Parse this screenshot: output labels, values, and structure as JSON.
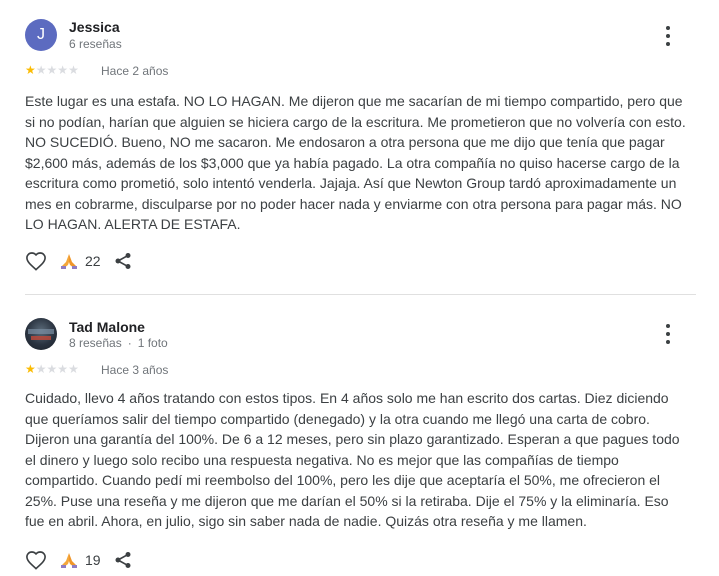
{
  "reviews": [
    {
      "author": "Jessica",
      "avatar_letter": "J",
      "meta": "6 reseñas",
      "rating": 1,
      "max_rating": 5,
      "time": "Hace 2 años",
      "text": "Este lugar es una estafa. NO LO HAGAN. Me dijeron que me sacarían de mi tiempo compartido, pero que si no podían, harían que alguien se hiciera cargo de la escritura. Me prometieron que no volvería con esto. NO SUCEDIÓ. Bueno, NO me sacaron. Me endosaron a otra persona que me dijo que tenía que pagar $2,600 más, además de los $3,000 que ya había pagado. La otra compañía no quiso hacerse cargo de la escritura como prometió, solo intentó venderla. Jajaja. Así que Newton Group tardó aproximadamente un mes en cobrarme, disculparse por no poder hacer nada y enviarme con otra persona para pagar más. NO LO HAGAN. ALERTA DE ESTAFA.",
      "reactions": "22"
    },
    {
      "author": "Tad Malone",
      "meta": "8 reseñas",
      "meta_extra": "1 foto",
      "meta_separator": "·",
      "rating": 1,
      "max_rating": 5,
      "time": "Hace 3 años",
      "text": "Cuidado, llevo 4 años tratando con estos tipos. En 4 años solo me han escrito dos cartas. Diez diciendo que queríamos salir del tiempo compartido (denegado) y la otra cuando me llegó una carta de cobro. Dijeron una garantía del 100%. De 6 a 12 meses, pero sin plazo garantizado. Esperan a que pagues todo el dinero y luego solo recibo una respuesta negativa. No es mejor que las compañías de tiempo compartido. Cuando pedí mi reembolso del 100%, pero les dije que aceptaría el 50%, me ofrecieron el 25%. Puse una reseña y me dijeron que me darían el 50% si la retiraba. Dije el 75% y la eliminaría. Eso fue en abril. Ahora, en julio, sigo sin saber nada de nadie. Quizás otra reseña y me llamen.",
      "reactions": "19"
    }
  ],
  "colors": {
    "star_on": "#fbbc04",
    "star_off": "#dadce0",
    "avatar_j": "#5c6bc0",
    "reaction_emoji": "#f4a73b"
  },
  "icons": {
    "like": "heart-outline-icon",
    "reaction": "folded-hands-emoji-icon",
    "share": "share-icon",
    "more": "more-vertical-icon"
  }
}
